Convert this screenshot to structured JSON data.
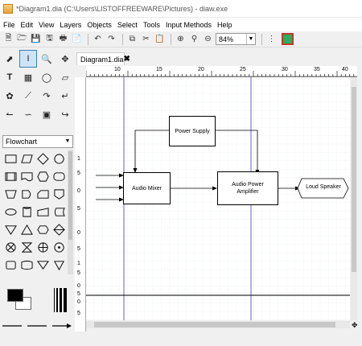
{
  "window": {
    "title": "*Diagram1.dia (C:\\Users\\LISTOFFREEWARE\\Pictures) - diaw.exe"
  },
  "menu": [
    "File",
    "Edit",
    "View",
    "Layers",
    "Objects",
    "Select",
    "Tools",
    "Input Methods",
    "Help"
  ],
  "toolbar": {
    "zoom": "84%"
  },
  "toolbox": {
    "sheet": "Flowchart"
  },
  "tab": {
    "label": "Diagram1.dia"
  },
  "rulers": {
    "horizontal": [
      "10",
      "15",
      "20",
      "25",
      "30",
      "35",
      "40"
    ],
    "vertical": [
      "1",
      "5",
      "0",
      "5",
      "0",
      "5",
      "1",
      "5",
      "0",
      "5",
      "0",
      "5"
    ]
  },
  "diagram": {
    "power_supply": "Power Supply",
    "audio_mixer": "Audio Mixer",
    "audio_power_amplifier_line1": "Audio Power",
    "audio_power_amplifier_line2": "Amplifier",
    "loud_speaker": "Loud Speaker"
  }
}
